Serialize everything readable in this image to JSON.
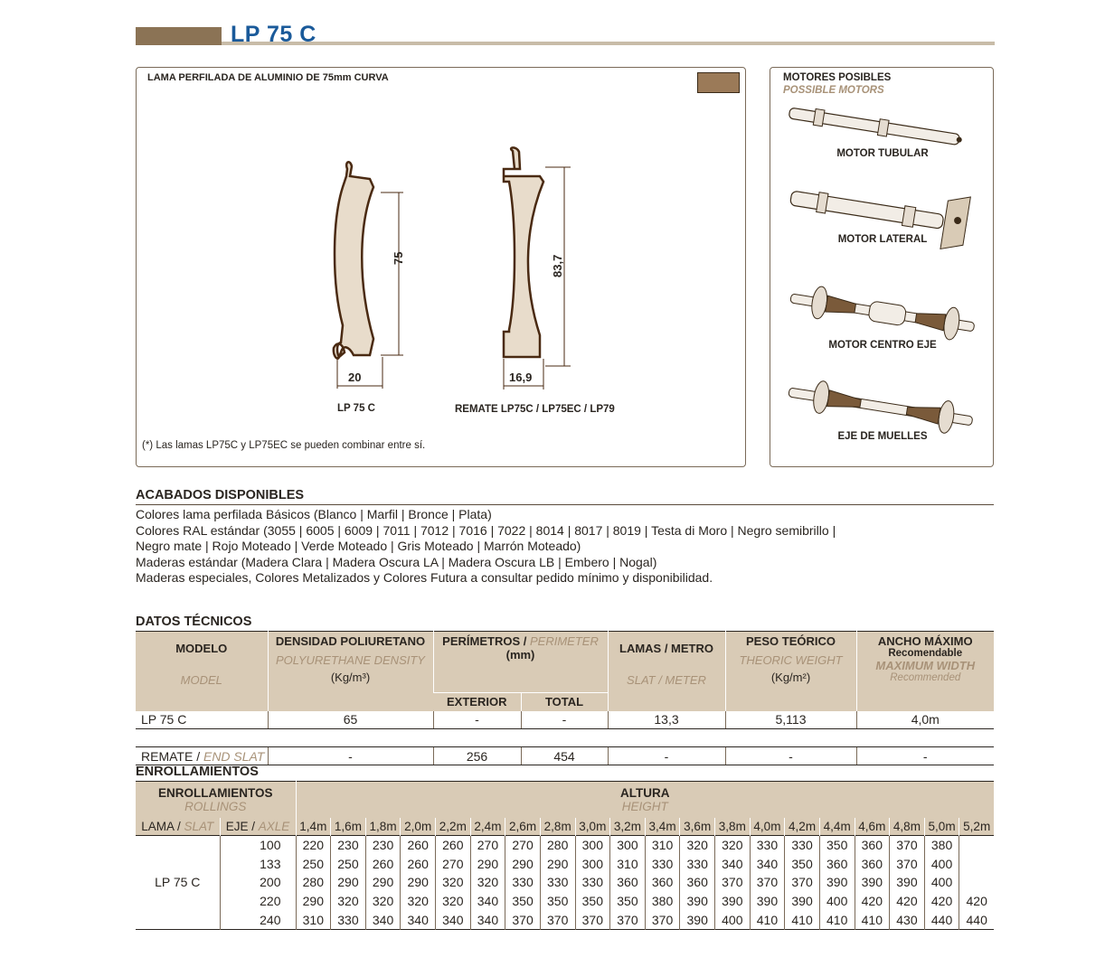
{
  "page": {
    "title": "LP 75 C"
  },
  "profile_panel": {
    "title": "LAMA PERFILADA DE ALUMINIO DE 75mm CURVA",
    "slat": {
      "height": "75",
      "width": "20",
      "label": "LP 75 C"
    },
    "end_slat": {
      "height": "83,7",
      "width": "16,9",
      "label": "REMATE LP75C / LP75EC / LP79"
    },
    "note": "(*) Las lamas LP75C y LP75EC se pueden combinar entre sí.",
    "swatch_color": "#9b7a58"
  },
  "motors": {
    "title": "MOTORES POSIBLES",
    "subtitle": "POSSIBLE MOTORS",
    "items": [
      "MOTOR TUBULAR",
      "MOTOR LATERAL",
      "MOTOR CENTRO EJE",
      "EJE DE MUELLES"
    ]
  },
  "finishes": {
    "heading": "ACABADOS DISPONIBLES",
    "lines": [
      "Colores lama perfilada Básicos (Blanco | Marfil | Bronce | Plata)",
      "Colores RAL estándar (3055 | 6005 | 6009 | 7011 | 7012 | 7016 | 7022 | 8014 | 8017 | 8019 | Testa di Moro | Negro semibrillo |",
      "Negro mate | Rojo Moteado | Verde Moteado | Gris Moteado | Marrón Moteado)",
      "Maderas estándar (Madera Clara | Madera Oscura LA | Madera Oscura LB | Embero | Nogal)",
      "Maderas especiales, Colores Metalizados y Colores Futura a consultar pedido mínimo y disponibilidad."
    ]
  },
  "tech": {
    "heading": "DATOS TÉCNICOS",
    "headers": {
      "model": "MODELO",
      "model_en": "MODEL",
      "density": "DENSIDAD POLIURETANO",
      "density_en": "POLYURETHANE DENSITY",
      "density_unit": "(Kg/m³)",
      "perimeter": "PERÍMETROS",
      "perimeter_en": "PERIMETER",
      "perimeter_unit": "(mm)",
      "exterior": "EXTERIOR",
      "total": "TOTAL",
      "slats": "LAMAS / METRO",
      "slats_en": "SLAT / METER",
      "weight": "PESO TEÓRICO",
      "weight_en": "THEORIC WEIGHT",
      "weight_unit": "(Kg/m²)",
      "width": "ANCHO MÁXIMO",
      "width_sub": "Recomendable",
      "width_en": "MAXIMUM WIDTH",
      "width_en_sub": "Recommended"
    },
    "row": {
      "model": "LP 75 C",
      "density": "65",
      "exterior": "-",
      "total": "-",
      "slats": "13,3",
      "weight": "5,113",
      "width": "4,0m"
    },
    "end_row": {
      "model": "REMATE",
      "model_en": "END SLAT",
      "density": "-",
      "exterior": "256",
      "total": "454",
      "slats": "-",
      "weight": "-",
      "width": "-"
    }
  },
  "rollings": {
    "heading": "ENROLLAMIENTOS",
    "h1": "ENROLLAMIENTOS",
    "h1_en": "ROLLINGS",
    "h2": "ALTURA",
    "h2_en": "HEIGHT",
    "lama": "LAMA",
    "lama_en": "SLAT",
    "eje": "EJE",
    "eje_en": "AXLE",
    "heights": [
      "1,4m",
      "1,6m",
      "1,8m",
      "2,0m",
      "2,2m",
      "2,4m",
      "2,6m",
      "2,8m",
      "3,0m",
      "3,2m",
      "3,4m",
      "3,6m",
      "3,8m",
      "4,0m",
      "4,2m",
      "4,4m",
      "4,6m",
      "4,8m",
      "5,0m",
      "5,2m"
    ],
    "model": "LP 75 C",
    "rows": [
      {
        "axle": "100",
        "values": [
          "220",
          "230",
          "230",
          "260",
          "260",
          "270",
          "270",
          "280",
          "300",
          "300",
          "310",
          "320",
          "320",
          "330",
          "330",
          "350",
          "360",
          "370",
          "380"
        ]
      },
      {
        "axle": "133",
        "values": [
          "250",
          "250",
          "260",
          "260",
          "270",
          "290",
          "290",
          "290",
          "300",
          "310",
          "330",
          "330",
          "340",
          "340",
          "350",
          "360",
          "360",
          "370",
          "400"
        ]
      },
      {
        "axle": "200",
        "values": [
          "280",
          "290",
          "290",
          "290",
          "320",
          "320",
          "330",
          "330",
          "330",
          "360",
          "360",
          "360",
          "370",
          "370",
          "370",
          "390",
          "390",
          "390",
          "400"
        ]
      },
      {
        "axle": "220",
        "values": [
          "290",
          "320",
          "320",
          "320",
          "320",
          "340",
          "350",
          "350",
          "350",
          "350",
          "380",
          "390",
          "390",
          "390",
          "390",
          "400",
          "420",
          "420",
          "420",
          "420"
        ]
      },
      {
        "axle": "240",
        "values": [
          "310",
          "330",
          "340",
          "340",
          "340",
          "340",
          "370",
          "370",
          "370",
          "370",
          "370",
          "390",
          "400",
          "410",
          "410",
          "410",
          "410",
          "430",
          "440",
          "440"
        ]
      }
    ]
  }
}
